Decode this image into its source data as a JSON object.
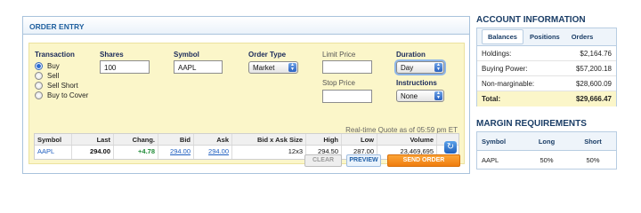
{
  "order_entry": {
    "title": "ORDER ENTRY",
    "transaction": {
      "label": "Transaction",
      "options": [
        "Buy",
        "Sell",
        "Sell Short",
        "Buy to Cover"
      ],
      "selected": "Buy"
    },
    "shares": {
      "label": "Shares",
      "value": "100"
    },
    "symbol": {
      "label": "Symbol",
      "value": "AAPL"
    },
    "order_type": {
      "label": "Order Type",
      "value": "Market"
    },
    "limit_price": {
      "label": "Limit Price",
      "value": ""
    },
    "stop_price": {
      "label": "Stop Price",
      "value": ""
    },
    "duration": {
      "label": "Duration",
      "value": "Day"
    },
    "instructions": {
      "label": "Instructions",
      "value": "None"
    },
    "quote_note": "Real-time Quote as of 05:59 pm ET",
    "quote_table": {
      "headers": [
        "Symbol",
        "Last",
        "Chang.",
        "Bid",
        "Ask",
        "Bid x Ask Size",
        "High",
        "Low",
        "Volume"
      ],
      "row": [
        "AAPL",
        "294.00",
        "+4.78",
        "294.00",
        "294.00",
        "12x3",
        "294.50",
        "287.00",
        "23,469,695"
      ]
    },
    "buttons": {
      "clear": "CLEAR",
      "preview": "PREVIEW",
      "send": "SEND ORDER"
    }
  },
  "account_information": {
    "title": "ACCOUNT INFORMATION",
    "tabs": [
      "Balances",
      "Positions",
      "Orders"
    ],
    "active_tab": "Balances",
    "rows": [
      {
        "label": "Holdings:",
        "value": "$2,164.76"
      },
      {
        "label": "Buying Power:",
        "value": "$57,200.18"
      },
      {
        "label": "Non-marginable:",
        "value": "$28,600.09"
      }
    ],
    "total": {
      "label": "Total:",
      "value": "$29,666.47"
    }
  },
  "margin_requirements": {
    "title": "MARGIN REQUIREMENTS",
    "headers": [
      "Symbol",
      "Long",
      "Short"
    ],
    "row": [
      "AAPL",
      "50%",
      "50%"
    ]
  },
  "colors": {
    "accent": "#1f5f9e",
    "send_button": "#f58a1f",
    "form_background": "#fbf6c9"
  }
}
